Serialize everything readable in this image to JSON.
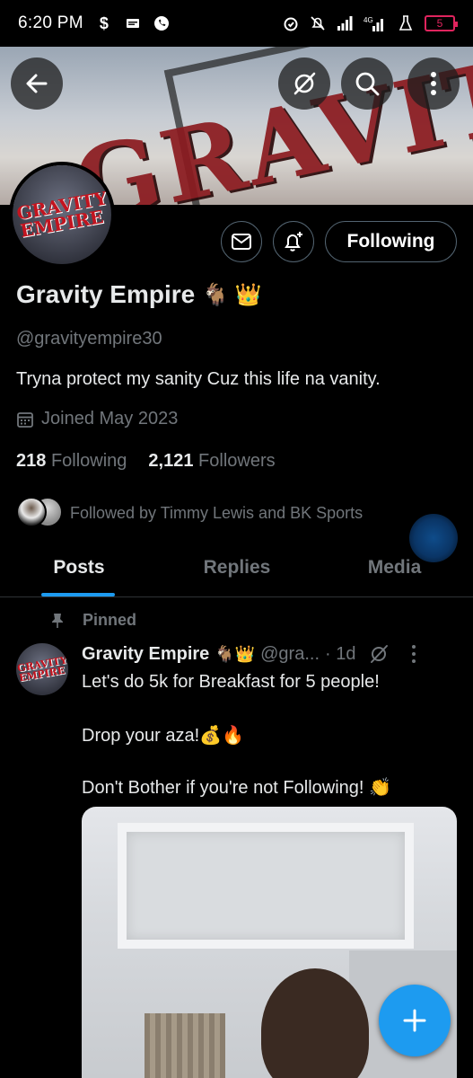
{
  "status_bar": {
    "time": "6:20 PM",
    "left_icons": [
      "dollar-icon",
      "message-icon",
      "whatsapp-icon"
    ],
    "right_icons": [
      "alarm-icon",
      "mute-icon",
      "signal-icon",
      "4g-signal-icon",
      "lab-icon"
    ],
    "battery": "5"
  },
  "banner": {
    "back_icon": "arrow-left-icon",
    "grok_icon": "grok-icon",
    "search_icon": "search-icon",
    "more_icon": "more-vertical-icon"
  },
  "avatar": {
    "text_line1": "GRAVITY",
    "text_line2": "EMPIRE"
  },
  "actions": {
    "message_icon": "envelope-icon",
    "notify_icon": "bell-plus-icon",
    "following_label": "Following"
  },
  "profile": {
    "name": "Gravity Empire",
    "name_emojis": "🐐 👑",
    "handle": "@gravityempire30",
    "bio": "Tryna protect my sanity Cuz this life na vanity.",
    "joined": "Joined May 2023",
    "following_count": "218",
    "following_label": "Following",
    "followers_count": "2,121",
    "followers_label": "Followers",
    "followed_by": "Followed by Timmy Lewis and BK Sports"
  },
  "tabs": [
    {
      "label": "Posts",
      "active": true
    },
    {
      "label": "Replies",
      "active": false
    },
    {
      "label": "Media",
      "active": false
    }
  ],
  "post": {
    "pinned_label": "Pinned",
    "author": "Gravity Empire",
    "author_emojis": "🐐👑",
    "handle": "@gra...",
    "time": "· 1d",
    "line1": "Let's do 5k for Breakfast for 5 people!",
    "line2": "Drop your aza!💰🔥",
    "line3": "Don't Bother if you're not Following! 👏"
  },
  "colors": {
    "accent": "#1d9bf0",
    "muted": "#71767b",
    "text": "#e7e9ea",
    "background": "#000000",
    "border": "#2f3336"
  }
}
